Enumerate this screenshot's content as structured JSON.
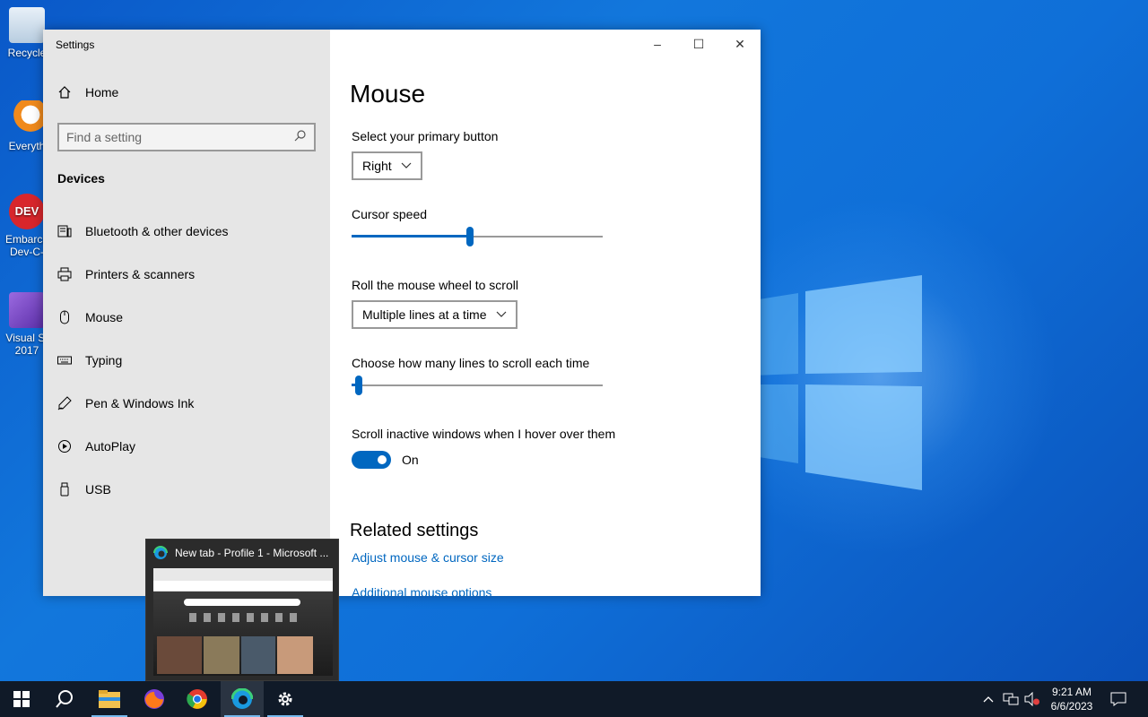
{
  "desktop": {
    "icons": [
      {
        "label": "Recycle",
        "color": "#d8e6f2"
      },
      {
        "label": "Everyth",
        "color": "#f08a1c"
      },
      {
        "label": "Embarca",
        "label2": "Dev-C-",
        "color": "#d8262c"
      },
      {
        "label": "Visual St",
        "label2": "2017",
        "color": "#7a45c8"
      }
    ]
  },
  "window": {
    "title": "Settings",
    "controls": {
      "minimize": "–",
      "maximize": "☐",
      "close": "✕"
    }
  },
  "sidebar": {
    "home_label": "Home",
    "search_placeholder": "Find a setting",
    "section": "Devices",
    "items": [
      {
        "label": "Bluetooth & other devices",
        "icon": "bluetooth-devices-icon"
      },
      {
        "label": "Printers & scanners",
        "icon": "printer-icon"
      },
      {
        "label": "Mouse",
        "icon": "mouse-icon"
      },
      {
        "label": "Typing",
        "icon": "keyboard-icon"
      },
      {
        "label": "Pen & Windows Ink",
        "icon": "pen-icon"
      },
      {
        "label": "AutoPlay",
        "icon": "autoplay-icon"
      },
      {
        "label": "USB",
        "icon": "usb-icon"
      }
    ]
  },
  "content": {
    "title": "Mouse",
    "primary_button": {
      "label": "Select your primary button",
      "value": "Right"
    },
    "cursor_speed": {
      "label": "Cursor speed",
      "value": 0.47
    },
    "wheel": {
      "label": "Roll the mouse wheel to scroll",
      "value": "Multiple lines at a time"
    },
    "lines": {
      "label": "Choose how many lines to scroll each time",
      "value": 0.03
    },
    "inactive": {
      "label": "Scroll inactive windows when I hover over them",
      "state": "On"
    },
    "related": {
      "title": "Related settings",
      "links": [
        "Adjust mouse & cursor size",
        "Additional mouse options"
      ]
    }
  },
  "thumbnail": {
    "title": "New tab - Profile 1 - Microsoft ..."
  },
  "taskbar": {
    "clock_time": "9:21 AM",
    "clock_date": "6/6/2023",
    "accent": "#76b9ed"
  },
  "colors": {
    "accent": "#0067c0",
    "sidebar_bg": "#e6e6e6"
  }
}
